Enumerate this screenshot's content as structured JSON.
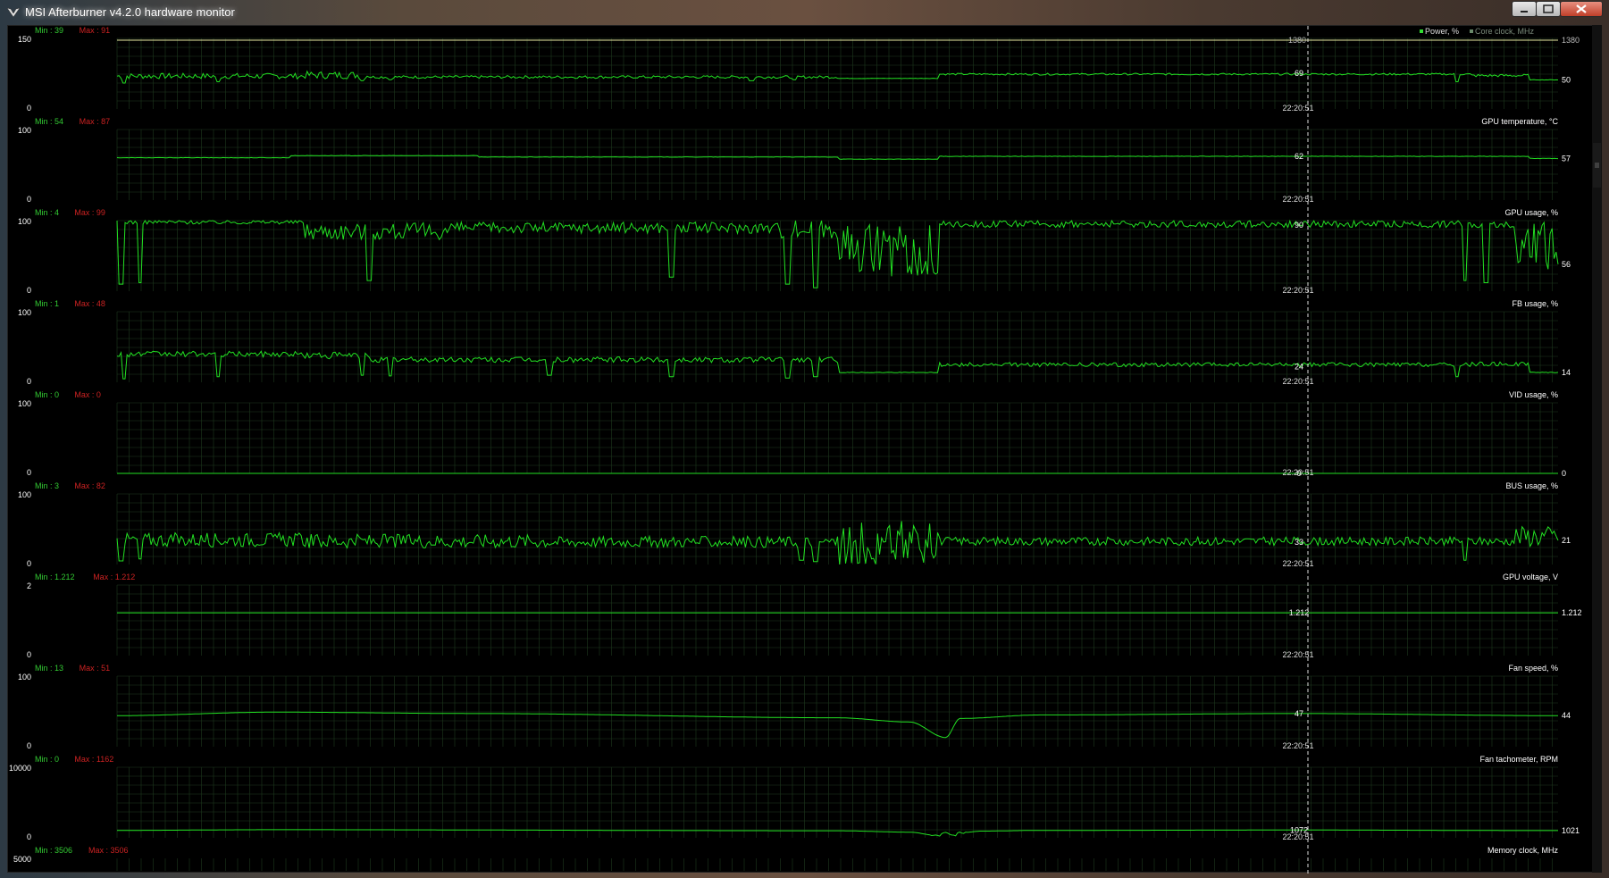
{
  "window": {
    "title": "MSI Afterburner v4.2.0 hardware monitor",
    "buttons": [
      "minimize",
      "maximize",
      "close"
    ]
  },
  "legend": {
    "items": [
      {
        "name": "Power, %",
        "color": "#33dd33"
      },
      {
        "name": "Core clock, MHz",
        "color": "#6a8a6a"
      }
    ]
  },
  "cursor_time": "22:20:51",
  "colors": {
    "line": "#22e022",
    "grid": "#1e3a1e",
    "min_text": "#33cc33",
    "max_text": "#cc2222",
    "label_text": "#ffffff",
    "dim_line": "#e8e8a0"
  },
  "chart_data": [
    {
      "type": "line",
      "title": "Power, %",
      "min_label": "Min : 39",
      "max_label": "Max : 91",
      "y_top": "150",
      "y_bottom": "0",
      "ylim": [
        0,
        150
      ],
      "cursor_value": "69",
      "current_value": "50",
      "secondary_cursor_value": "1380",
      "secondary_current_value": "1380",
      "segments": [
        [
          0,
          70,
          6
        ],
        [
          0.13,
          72,
          8
        ],
        [
          0.175,
          68,
          3
        ],
        [
          0.5,
          65,
          0.5
        ],
        [
          0.57,
          74,
          2
        ],
        [
          0.94,
          71,
          3
        ],
        [
          0.98,
          62,
          0.5
        ],
        [
          1,
          62,
          0
        ]
      ],
      "dips": [
        [
          0.005,
          55
        ],
        [
          0.07,
          58
        ],
        [
          0.17,
          60
        ],
        [
          0.19,
          62
        ],
        [
          0.44,
          60
        ],
        [
          0.47,
          62
        ],
        [
          0.93,
          58
        ]
      ]
    },
    {
      "type": "line",
      "title": "GPU temperature, °C",
      "min_label": "Min : 54",
      "max_label": "Max : 87",
      "y_top": "100",
      "y_bottom": "0",
      "ylim": [
        0,
        100
      ],
      "cursor_value": "62",
      "current_value": "57",
      "segments": [
        [
          0,
          60,
          0.3
        ],
        [
          0.12,
          63,
          0.3
        ],
        [
          0.25,
          61,
          0.3
        ],
        [
          0.5,
          58,
          0.3
        ],
        [
          0.57,
          62,
          0.3
        ],
        [
          0.98,
          59,
          0.3
        ],
        [
          1,
          58,
          0
        ]
      ],
      "dips": []
    },
    {
      "type": "line",
      "title": "GPU usage, %",
      "min_label": "Min : 4",
      "max_label": "Max : 99",
      "y_top": "100",
      "y_bottom": "0",
      "ylim": [
        0,
        100
      ],
      "cursor_value": "90",
      "current_value": "56",
      "segments": [
        [
          0,
          98,
          3
        ],
        [
          0.13,
          85,
          12
        ],
        [
          0.23,
          90,
          8
        ],
        [
          0.46,
          88,
          14
        ],
        [
          0.5,
          70,
          25
        ],
        [
          0.57,
          95,
          5
        ],
        [
          0.97,
          80,
          25
        ],
        [
          1,
          56,
          0
        ]
      ],
      "dips": [
        [
          0.003,
          10
        ],
        [
          0.016,
          12
        ],
        [
          0.175,
          15
        ],
        [
          0.385,
          20
        ],
        [
          0.465,
          10
        ],
        [
          0.485,
          5
        ],
        [
          0.935,
          15
        ],
        [
          0.95,
          12
        ]
      ]
    },
    {
      "type": "line",
      "title": "FB usage, %",
      "min_label": "Min : 1",
      "max_label": "Max : 48",
      "y_top": "100",
      "y_bottom": "0",
      "ylim": [
        0,
        100
      ],
      "cursor_value": "24",
      "current_value": "14",
      "segments": [
        [
          0,
          40,
          4
        ],
        [
          0.13,
          38,
          5
        ],
        [
          0.175,
          32,
          4
        ],
        [
          0.5,
          14,
          0.5
        ],
        [
          0.57,
          25,
          3
        ],
        [
          0.94,
          26,
          3
        ],
        [
          0.98,
          14,
          0.5
        ],
        [
          1,
          14,
          0
        ]
      ],
      "dips": [
        [
          0.005,
          5
        ],
        [
          0.07,
          8
        ],
        [
          0.17,
          10
        ],
        [
          0.19,
          9
        ],
        [
          0.3,
          10
        ],
        [
          0.385,
          8
        ],
        [
          0.465,
          6
        ],
        [
          0.485,
          8
        ],
        [
          0.93,
          8
        ]
      ]
    },
    {
      "type": "line",
      "title": "VID usage, %",
      "min_label": "Min : 0",
      "max_label": "Max : 0",
      "y_top": "100",
      "y_bottom": "0",
      "ylim": [
        0,
        100
      ],
      "cursor_value": "0",
      "current_value": "0",
      "segments": [
        [
          0,
          0,
          0
        ],
        [
          1,
          0,
          0
        ]
      ],
      "dips": []
    },
    {
      "type": "line",
      "title": "BUS usage, %",
      "min_label": "Min : 3",
      "max_label": "Max : 82",
      "y_top": "100",
      "y_bottom": "0",
      "ylim": [
        0,
        100
      ],
      "cursor_value": "33",
      "current_value": "21",
      "segments": [
        [
          0,
          35,
          10
        ],
        [
          0.13,
          33,
          10
        ],
        [
          0.3,
          32,
          8
        ],
        [
          0.5,
          40,
          22
        ],
        [
          0.57,
          33,
          6
        ],
        [
          0.97,
          40,
          15
        ],
        [
          1,
          21,
          0
        ]
      ],
      "dips": [
        [
          0.003,
          5
        ],
        [
          0.016,
          8
        ],
        [
          0.475,
          6
        ],
        [
          0.485,
          4
        ],
        [
          0.935,
          6
        ]
      ]
    },
    {
      "type": "line",
      "title": "GPU voltage, V",
      "min_label": "Min : 1.212",
      "max_label": "Max : 1.212",
      "y_top": "2",
      "y_bottom": "0",
      "ylim": [
        0,
        2
      ],
      "cursor_value": "1.212",
      "current_value": "1.212",
      "segments": [
        [
          0,
          1.212,
          0
        ],
        [
          1,
          1.212,
          0
        ]
      ],
      "dips": []
    },
    {
      "type": "line",
      "title": "Fan speed, %",
      "min_label": "Min : 13",
      "max_label": "Max : 51",
      "y_top": "100",
      "y_bottom": "0",
      "ylim": [
        0,
        100
      ],
      "cursor_value": "47",
      "current_value": "44",
      "smooth": [
        [
          0,
          44
        ],
        [
          0.11,
          49
        ],
        [
          0.25,
          47
        ],
        [
          0.5,
          41
        ],
        [
          0.55,
          35
        ],
        [
          0.575,
          13
        ],
        [
          0.585,
          40
        ],
        [
          0.64,
          45
        ],
        [
          0.82,
          47
        ],
        [
          1,
          44
        ]
      ]
    },
    {
      "type": "line",
      "title": "Fan tachometer, RPM",
      "min_label": "Min : 0",
      "max_label": "Max : 1162",
      "y_top": "10000",
      "y_bottom": "0",
      "ylim": [
        0,
        10000
      ],
      "cursor_value": "1072",
      "current_value": "1021",
      "smooth": [
        [
          0,
          1050
        ],
        [
          0.11,
          1150
        ],
        [
          0.5,
          1000
        ],
        [
          0.55,
          800
        ],
        [
          0.57,
          300
        ],
        [
          0.575,
          800
        ],
        [
          0.58,
          250
        ],
        [
          0.585,
          700
        ],
        [
          0.6,
          950
        ],
        [
          0.64,
          1050
        ],
        [
          0.82,
          1100
        ],
        [
          1,
          1021
        ]
      ]
    },
    {
      "type": "line",
      "title": "Memory clock, MHz",
      "min_label": "Min : 3506",
      "max_label": "Max : 3506",
      "y_top": "5000",
      "y_bottom": "",
      "ylim": [
        0,
        5000
      ],
      "cursor_value": "",
      "current_value": "",
      "partial": true,
      "segments": [],
      "dips": []
    }
  ]
}
